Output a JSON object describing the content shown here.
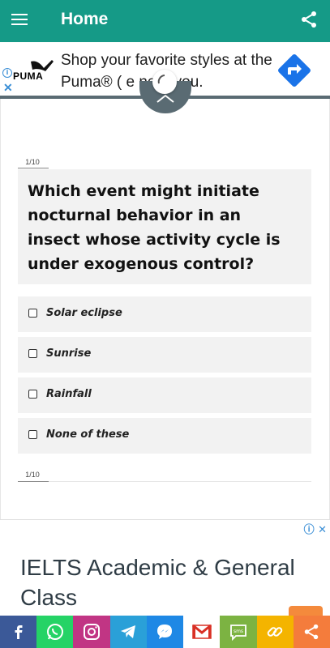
{
  "app": {
    "title": "Home"
  },
  "ad_top": {
    "brand": "PUMA",
    "text": "Shop your favorite styles at the Puma® ( e near you."
  },
  "quiz": {
    "counter": "1/10",
    "question": "Which event might initiate nocturnal behavior in an insect whose activity cycle is under exogenous control?",
    "options": [
      "Solar eclipse",
      "Sunrise",
      "Rainfall",
      "None of these"
    ]
  },
  "ad_bottom": {
    "headline": "IELTS Academic & General Class"
  },
  "share_bar": [
    {
      "name": "facebook",
      "color": "#3b5998"
    },
    {
      "name": "whatsapp",
      "color": "#25d366"
    },
    {
      "name": "instagram",
      "color": "#c13584"
    },
    {
      "name": "telegram",
      "color": "#2aa0d8"
    },
    {
      "name": "messenger",
      "color": "#1e88e5"
    },
    {
      "name": "gmail",
      "color": "#ffffff"
    },
    {
      "name": "sms",
      "color": "#7cb342"
    },
    {
      "name": "link",
      "color": "#f4b400"
    },
    {
      "name": "share",
      "color": "#f47c3c"
    }
  ]
}
